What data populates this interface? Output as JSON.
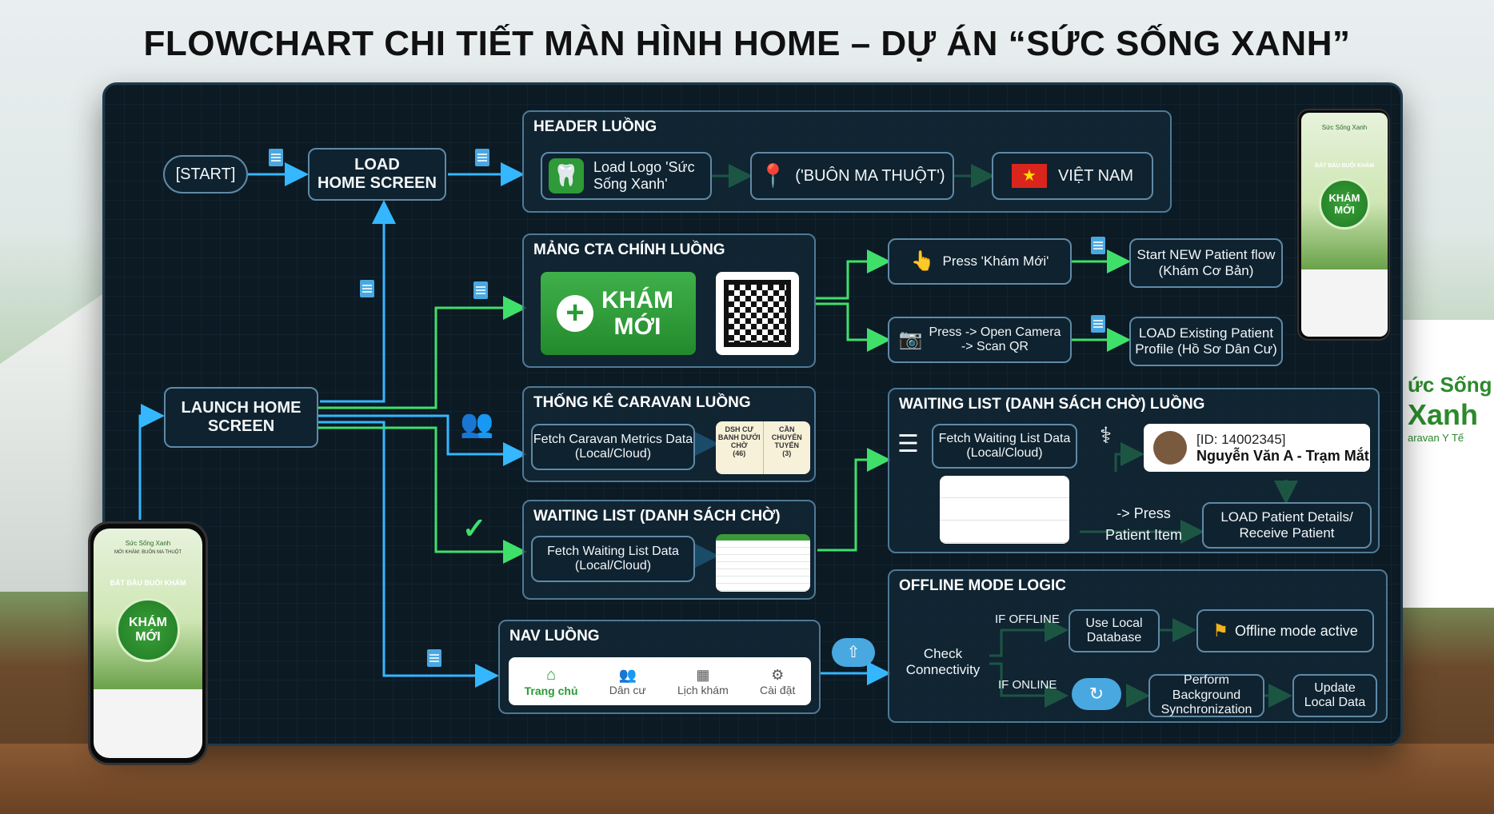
{
  "title": "FLOWCHART CHI TIẾT MÀN HÌNH HOME – DỰ ÁN “SỨC SỐNG XANH”",
  "nodes": {
    "start": "[START]",
    "load_home_l1": "LOAD",
    "load_home_l2": "HOME SCREEN",
    "launch_l1": "LAUNCH HOME",
    "launch_l2": "SCREEN"
  },
  "header_group": {
    "title": "HEADER LUỒNG",
    "logo_l1": "Load Logo 'Sức",
    "logo_l2": "Sống Xanh'",
    "location": "('BUÔN MA THUỘT')",
    "country": "VIỆT NAM"
  },
  "cta_group": {
    "title": "MẢNG CTA CHÍNH LUỒNG",
    "kham_l1": "KHÁM",
    "kham_l2": "MỚI",
    "press_kham": "Press 'Khám Mới'",
    "start_new_l1": "Start NEW Patient flow",
    "start_new_l2": "(Khám Cơ Bản)",
    "press_camera_l1": "Press -> Open Camera",
    "press_camera_l2": "-> Scan QR",
    "load_existing_l1": "LOAD Existing Patient",
    "load_existing_l2": "Profile (Hồ Sơ Dân Cư)"
  },
  "caravan_group": {
    "title": "THỐNG KÊ CARAVAN LUỒNG",
    "fetch_l1": "Fetch Caravan Metrics Data",
    "fetch_l2": "(Local/Cloud)",
    "metric1_l1": "DSH CƯ",
    "metric1_l2": "BANH DƯỚI",
    "metric1_l3": "CHỜ",
    "metric1_val": "(46)",
    "metric2_l1": "CẦN",
    "metric2_l2": "CHUYỂN",
    "metric2_l3": "TUYẾN",
    "metric2_val": "(3)"
  },
  "waiting_small_group": {
    "title": "WAITING LIST (DANH SÁCH CHỜ)",
    "fetch_l1": "Fetch Waiting List Data",
    "fetch_l2": "(Local/Cloud)"
  },
  "waiting_big_group": {
    "title": "WAITING LIST (DANH SÁCH CHỜ) LUỒNG",
    "fetch_l1": "Fetch Waiting List Data",
    "fetch_l2": "(Local/Cloud)",
    "patient_id": "[ID: 14002345]",
    "patient_name": "Nguyễn Văn A - Trạm Mắt",
    "press_l1": "-> Press",
    "press_l2": "Patient Item",
    "load_details_l1": "LOAD Patient Details/",
    "load_details_l2": "Receive Patient"
  },
  "nav_group": {
    "title": "NAV LUỒNG",
    "tabs": [
      "Trang chủ",
      "Dân cư",
      "Lịch khám",
      "Cài đặt"
    ]
  },
  "offline_group": {
    "title": "OFFLINE MODE LOGIC",
    "check_l1": "Check",
    "check_l2": "Connectivity",
    "if_offline": "IF OFFLINE",
    "if_online": "IF ONLINE",
    "use_local_l1": "Use Local",
    "use_local_l2": "Database",
    "offline_active": "Offline mode active",
    "perform_l1": "Perform Background",
    "perform_l2": "Synchronization",
    "update_l1": "Update",
    "update_l2": "Local Data"
  },
  "phone_left": {
    "app_name": "Sức Sống Xanh",
    "subtitle": "MỜI KHÁM: BUÔN MA THUỘT",
    "banner": "BẮT ĐẦU BUỔI KHÁM",
    "kham_l1": "KHÁM",
    "kham_l2": "MỚI"
  },
  "phone_right": {
    "app_name": "Sức Sống Xanh",
    "banner": "BẮT ĐẦU BUỔI KHÁM",
    "kham_l1": "KHÁM",
    "kham_l2": "MỚI"
  },
  "banner_text": {
    "l1": "ức Sống",
    "l2": "Xanh",
    "l3": "aravan Y Tế"
  },
  "colors": {
    "board": "#0c1a24",
    "wire_blue": "#35b7ff",
    "wire_green": "#3fe06a",
    "primary_green": "#2f9a34"
  }
}
